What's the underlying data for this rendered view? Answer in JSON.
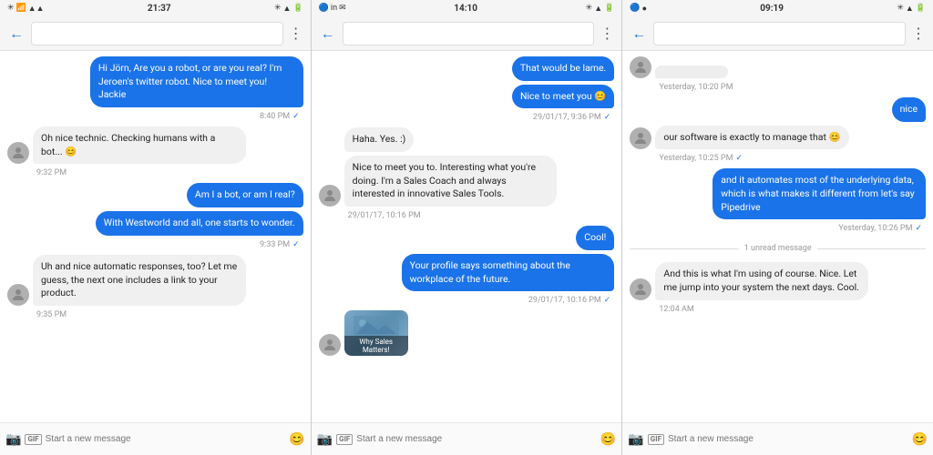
{
  "phones": [
    {
      "id": "phone1",
      "statusBar": {
        "left": "BT WiFi signal",
        "time": "21:37",
        "icons": "🔵📶🔋"
      },
      "navBar": {
        "backArrow": "←",
        "menuIcon": "⋮"
      },
      "messages": [
        {
          "id": "m1",
          "type": "sent",
          "text": "Hi Jörn, Are you a robot, or are you real? I'm Jeroen's twitter robot. Nice to meet you! Jackie",
          "time": "8:40 PM",
          "check": true
        },
        {
          "id": "m2",
          "type": "received",
          "text": "Oh nice technic. Checking humans with a bot... 😊",
          "time": "9:32 PM",
          "check": false,
          "hasAvatar": true
        },
        {
          "id": "m3",
          "type": "sent",
          "text": "Am I a bot, or am I real?",
          "time": null,
          "check": false
        },
        {
          "id": "m4",
          "type": "sent",
          "text": "With Westworld and all, one starts to wonder.",
          "time": "9:33 PM",
          "check": true
        },
        {
          "id": "m5",
          "type": "received",
          "text": "Uh and nice automatic responses, too? Let me guess, the next one includes a link to your product.",
          "time": "9:35 PM",
          "check": false,
          "hasAvatar": true
        }
      ],
      "inputBar": {
        "placeholder": "Start a new message",
        "cameraIcon": "📷",
        "gifLabel": "GIF",
        "emojiIcon": "😊"
      }
    },
    {
      "id": "phone2",
      "statusBar": {
        "left": "icons",
        "time": "14:10",
        "icons": "🔵📶🔋"
      },
      "navBar": {
        "backArrow": "←",
        "menuIcon": "⋮"
      },
      "messages": [
        {
          "id": "m1",
          "type": "sent",
          "text": "That would be lame.",
          "time": null,
          "check": false
        },
        {
          "id": "m2",
          "type": "sent",
          "text": "Nice to meet you 😊",
          "time": "29/01/17, 9:36 PM",
          "check": true
        },
        {
          "id": "m3",
          "type": "received",
          "text": "Haha. Yes. :)",
          "time": null,
          "check": false,
          "hasAvatar": false
        },
        {
          "id": "m4",
          "type": "received",
          "text": "Nice to meet you to. Interesting what you're doing. I'm a Sales Coach and always interested in innovative Sales Tools.",
          "time": "29/01/17, 10:16 PM",
          "check": false,
          "hasAvatar": true
        },
        {
          "id": "m5",
          "type": "sent",
          "text": "Cool!",
          "time": null,
          "check": false
        },
        {
          "id": "m6",
          "type": "sent",
          "text": "Your profile says something about the workplace of the future.",
          "time": "29/01/17, 10:16 PM",
          "check": true
        },
        {
          "id": "m7",
          "type": "received-image",
          "imageText": "Why Sales Matters!",
          "hasAvatar": true
        }
      ],
      "inputBar": {
        "placeholder": "Start a new message",
        "cameraIcon": "📷",
        "gifLabel": "GIF",
        "emojiIcon": "😊"
      }
    },
    {
      "id": "phone3",
      "statusBar": {
        "left": "icons",
        "time": "09:19",
        "icons": "🔵📶🔋"
      },
      "navBar": {
        "backArrow": "←",
        "menuIcon": "⋮"
      },
      "messages": [
        {
          "id": "m0",
          "type": "received-partial",
          "text": "...",
          "hasAvatar": false
        },
        {
          "id": "m0t",
          "type": "timestamp-only",
          "time": "Yesterday, 10:20 PM"
        },
        {
          "id": "m1",
          "type": "sent",
          "text": "nice",
          "time": null,
          "check": false
        },
        {
          "id": "m2",
          "type": "received",
          "text": "our software is exactly to manage that 😊",
          "time": "Yesterday, 10:25 PM",
          "check": true,
          "hasAvatar": true
        },
        {
          "id": "m3",
          "type": "sent",
          "text": "and it automates most of the underlying data, which is what makes it different from let's say Pipedrive",
          "time": "Yesterday, 10:26 PM",
          "check": true
        },
        {
          "id": "unread",
          "type": "unread-divider",
          "text": "1 unread message"
        },
        {
          "id": "m4",
          "type": "received",
          "text": "And this is what I'm using of course. Nice. Let me jump into your system the next days. Cool.",
          "time": "12:04 AM",
          "check": false,
          "hasAvatar": true
        }
      ],
      "inputBar": {
        "placeholder": "Start a new message",
        "cameraIcon": "📷",
        "gifLabel": "GIF",
        "emojiIcon": "😊"
      }
    }
  ]
}
